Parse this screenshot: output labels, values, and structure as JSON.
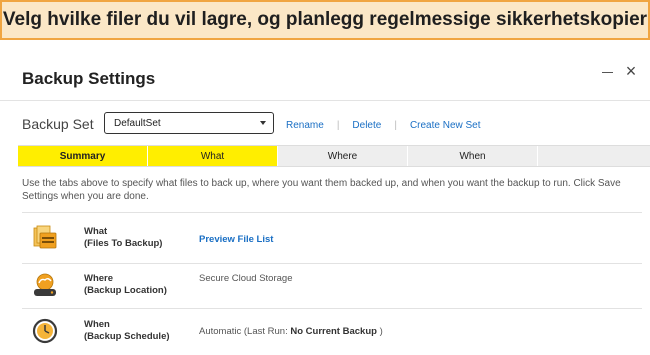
{
  "banner": {
    "text": "Velg hvilke filer du vil lagre, og planlegg regelmessige sikkerhetskopier"
  },
  "dialog": {
    "title": "Backup Settings",
    "backup_set_label": "Backup Set",
    "backup_set_value": "DefaultSet",
    "links": {
      "rename": "Rename",
      "delete": "Delete",
      "create": "Create New Set"
    }
  },
  "tabs": [
    {
      "label": "Summary"
    },
    {
      "label": "What"
    },
    {
      "label": "Where"
    },
    {
      "label": "When"
    }
  ],
  "intro": "Use the tabs above to specify what files to back up, where you want them backed up, and when you want the backup to run. Click Save Settings when you are done.",
  "rows": {
    "what": {
      "title": "What",
      "subtitle": "(Files To Backup)",
      "value": "Preview File List",
      "icon": "files-folder-icon"
    },
    "where": {
      "title": "Where",
      "subtitle": "(Backup Location)",
      "value": "Secure Cloud Storage",
      "icon": "cloud-drive-icon"
    },
    "when": {
      "title": "When",
      "subtitle": "(Backup Schedule)",
      "value_prefix": "Automatic (Last Run: ",
      "value_bold": "No Current Backup",
      "value_suffix": " )",
      "icon": "clock-icon"
    }
  },
  "colors": {
    "active_tab": "#ffee00",
    "link": "#1a6fc4",
    "banner_border": "#f0a541",
    "banner_bg": "#fbe7c6",
    "icon_orange": "#f0a020"
  }
}
